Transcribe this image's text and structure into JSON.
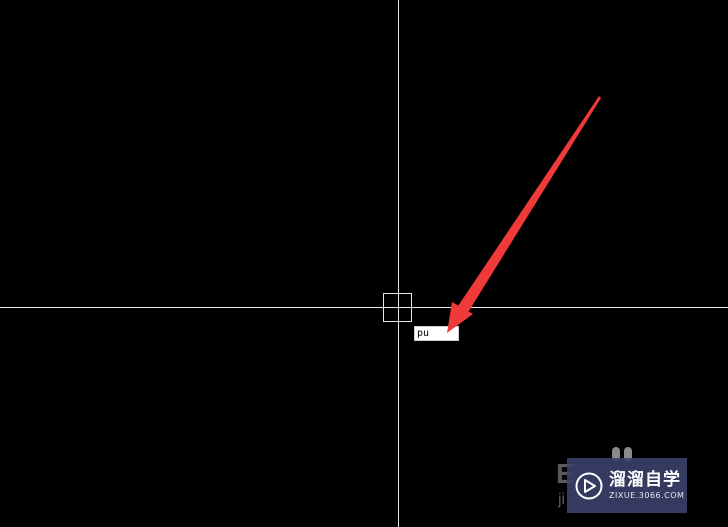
{
  "drawing_area": {
    "background_color": "#000000",
    "crosshair_color": "#e8e8e8"
  },
  "command_input": {
    "value": "pu"
  },
  "annotation": {
    "arrow_color": "#f03a3a",
    "icon": "red-arrow-icon"
  },
  "background_text": {
    "large": "E",
    "small": "ji"
  },
  "watermark": {
    "title": "溜溜自学",
    "url": "ZIXUE.3066.COM",
    "logo_icon": "play-badge-icon",
    "background_color": "#3c426e"
  }
}
